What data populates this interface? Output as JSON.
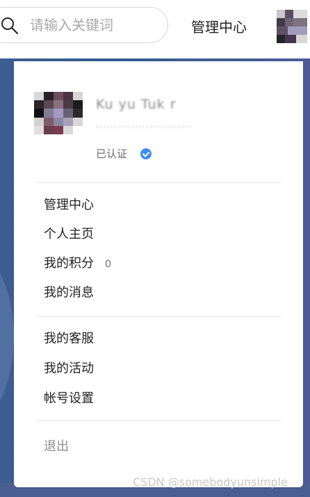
{
  "header": {
    "search": {
      "placeholder": "请输入关键词",
      "icon": "search-icon"
    },
    "management_link": "管理中心",
    "avatar_icon": "avatar"
  },
  "profile": {
    "name_blurred": "Ku yu Tuk r",
    "subline_blurred": "...........................",
    "verified_text": "已认证",
    "verified_icon": "check-circle-icon",
    "verified_color": "#3d8ef7"
  },
  "menu": {
    "group1": [
      {
        "label": "管理中心"
      },
      {
        "label": "个人主页"
      },
      {
        "label": "我的积分",
        "count": "0"
      },
      {
        "label": "我的消息"
      }
    ],
    "group2": [
      {
        "label": "我的客服"
      },
      {
        "label": "我的活动"
      },
      {
        "label": "帐号设置"
      }
    ],
    "logout": "退出"
  },
  "watermark": "CSDN @somebodyunsimple",
  "colors": {
    "backdrop": "#3d5d93",
    "divider": "#e6e6e6",
    "text": "#222222",
    "muted": "#8d8d8d"
  }
}
